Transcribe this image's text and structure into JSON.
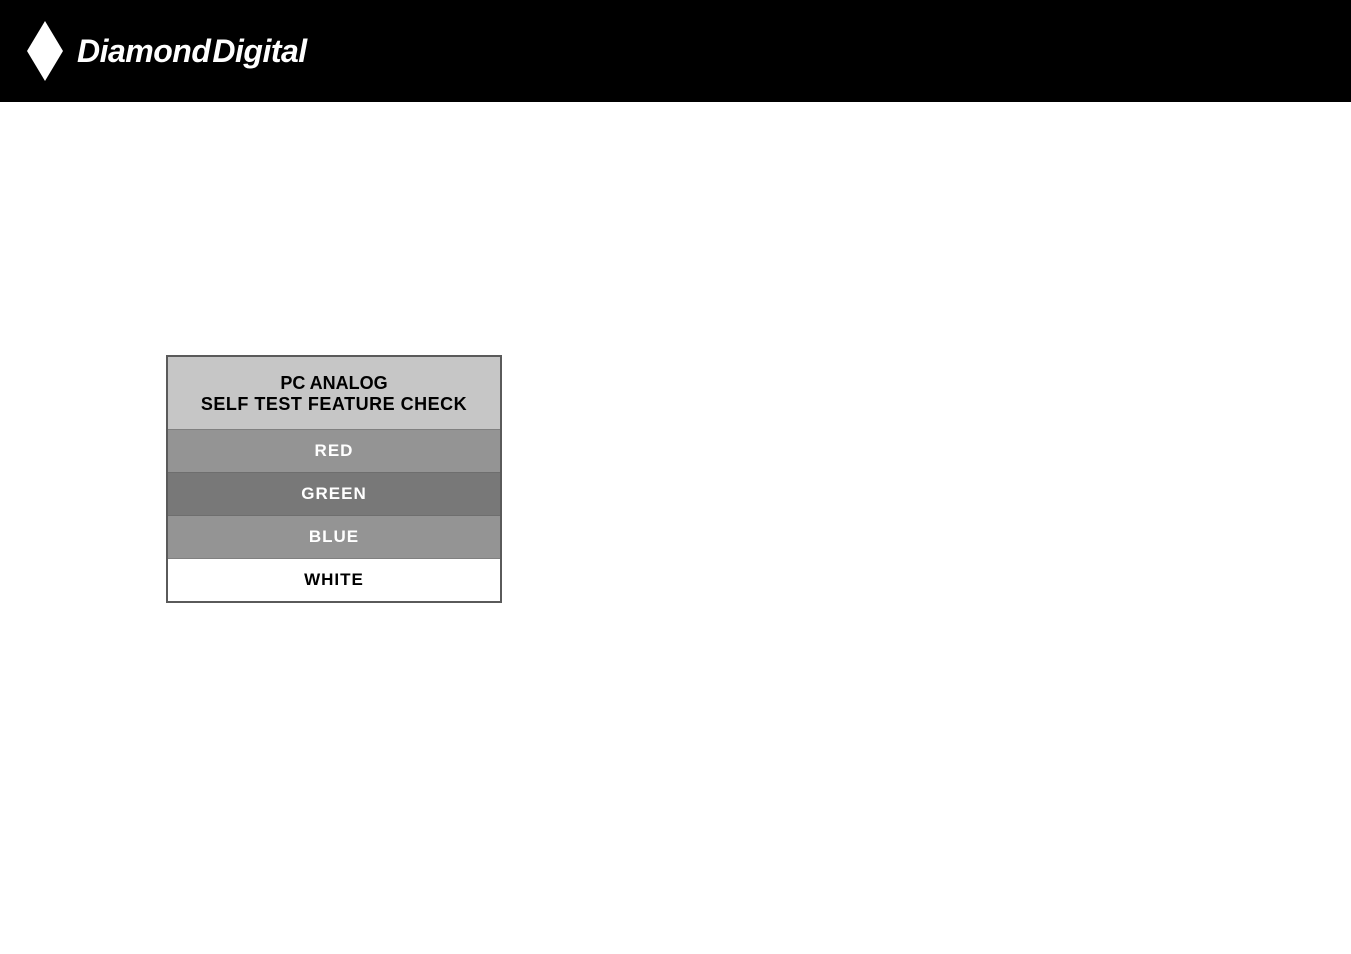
{
  "header": {
    "brand_word1": "Diamond",
    "brand_word2": "Digital"
  },
  "self_test": {
    "title_line1": "PC ANALOG",
    "title_line2": "SELF TEST FEATURE CHECK",
    "rows": {
      "red": "RED",
      "green": "GREEN",
      "blue": "BLUE",
      "white": "WHITE"
    }
  }
}
